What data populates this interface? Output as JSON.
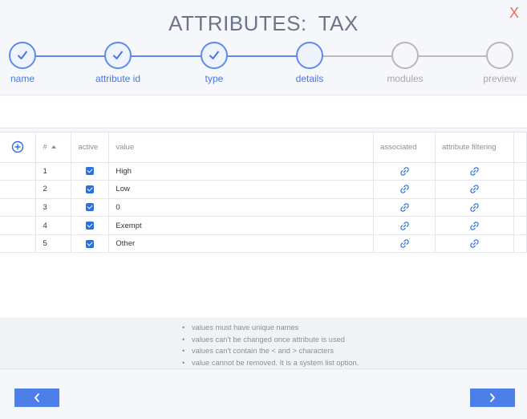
{
  "header": {
    "title_word1": "ATTRIBUTES:",
    "title_word2": "TAX",
    "close_label": "X"
  },
  "stepper": {
    "steps": [
      {
        "label": "name",
        "state": "done"
      },
      {
        "label": "attribute id",
        "state": "done"
      },
      {
        "label": "type",
        "state": "done"
      },
      {
        "label": "details",
        "state": "current"
      },
      {
        "label": "modules",
        "state": "future"
      },
      {
        "label": "preview",
        "state": "future"
      }
    ]
  },
  "table": {
    "headers": {
      "number": "#",
      "active": "active",
      "value": "value",
      "associated": "associated",
      "attribute_filtering": "attribute filtering"
    },
    "rows": [
      {
        "number": "1",
        "active": true,
        "value": "High"
      },
      {
        "number": "2",
        "active": true,
        "value": "Low"
      },
      {
        "number": "3",
        "active": true,
        "value": "0"
      },
      {
        "number": "4",
        "active": true,
        "value": "Exempt"
      },
      {
        "number": "5",
        "active": true,
        "value": "Other"
      }
    ]
  },
  "notes": [
    "values must have unique names",
    "values can't be changed once attribute is used",
    "values can't contain the < and > characters",
    "value cannot be removed. It is a system list option."
  ],
  "colors": {
    "accent": "#4d7fe9",
    "close": "#f26a55",
    "future": "#b8b8b8"
  },
  "icons": {
    "add": "plus-circle-icon",
    "link": "link-icon",
    "back": "chevron-left-icon",
    "next": "chevron-right-icon"
  }
}
